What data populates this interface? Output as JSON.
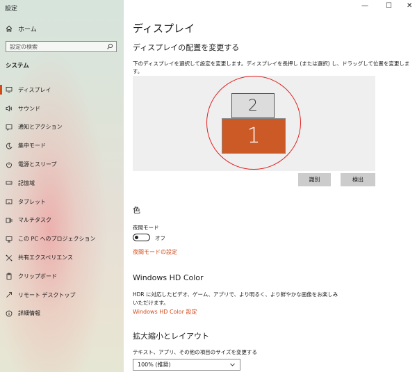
{
  "app": {
    "title": "設定"
  },
  "window_controls": {
    "minimize": "—",
    "maximize": "☐",
    "close": "✕"
  },
  "sidebar": {
    "home_label": "ホーム",
    "search_placeholder": "設定の検索",
    "section_title": "システム",
    "items": [
      {
        "label": "ディスプレイ",
        "icon": "monitor-icon"
      },
      {
        "label": "サウンド",
        "icon": "speaker-icon"
      },
      {
        "label": "通知とアクション",
        "icon": "notification-icon"
      },
      {
        "label": "集中モード",
        "icon": "moon-icon"
      },
      {
        "label": "電源とスリープ",
        "icon": "power-icon"
      },
      {
        "label": "記憶域",
        "icon": "storage-icon"
      },
      {
        "label": "タブレット",
        "icon": "tablet-icon"
      },
      {
        "label": "マルチタスク",
        "icon": "multitask-icon"
      },
      {
        "label": "この PC へのプロジェクション",
        "icon": "projection-icon"
      },
      {
        "label": "共有エクスペリエンス",
        "icon": "share-icon"
      },
      {
        "label": "クリップボード",
        "icon": "clipboard-icon"
      },
      {
        "label": "リモート デスクトップ",
        "icon": "remote-icon"
      },
      {
        "label": "詳細情報",
        "icon": "info-icon"
      }
    ]
  },
  "main": {
    "title": "ディスプレイ",
    "arrange": {
      "heading": "ディスプレイの配置を変更する",
      "description": "下のディスプレイを選択して設定を変更します。ディスプレイを長押し (または選択) し、ドラッグして位置を変更します。",
      "monitor_top": "2",
      "monitor_bottom": "1",
      "identify_label": "識別",
      "detect_label": "検出"
    },
    "color": {
      "heading": "色",
      "night_light_label": "夜間モード",
      "toggle_state": "オフ",
      "night_light_link": "夜間モードの設定"
    },
    "hdr": {
      "heading": "Windows HD Color",
      "description_line1": "HDR に対応したビデオ、ゲーム、アプリで、より明るく、より鮮やかな画像をお楽しみ",
      "description_line2": "いただけます。",
      "link": "Windows HD Color 設定"
    },
    "scale": {
      "heading": "拡大縮小とレイアウト",
      "label": "テキスト、アプリ、その他の項目のサイズを変更する",
      "value": "100% (推奨)"
    }
  }
}
